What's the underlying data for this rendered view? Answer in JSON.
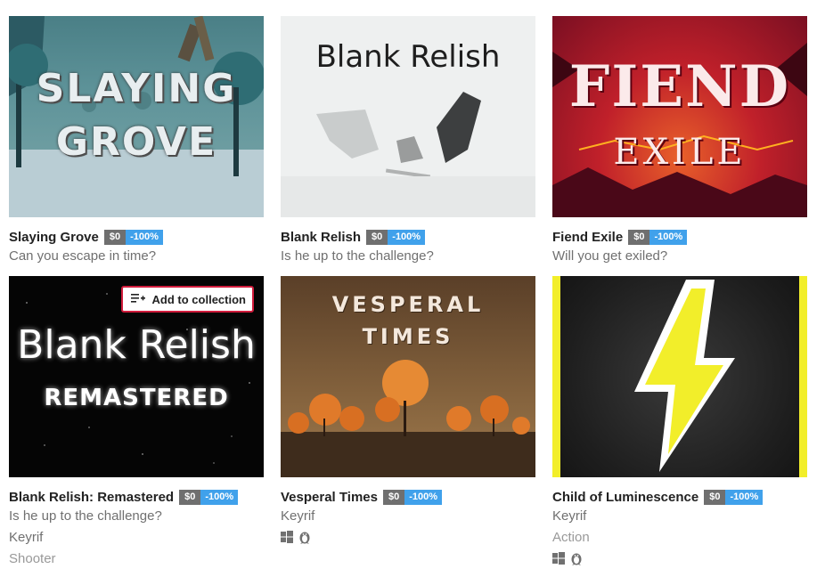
{
  "games": [
    {
      "title": "Slaying Grove",
      "price": "$0",
      "discount": "-100%",
      "description": "Can you escape in time?",
      "cover_text": [
        "SLAYING",
        "GROVE"
      ]
    },
    {
      "title": "Blank Relish",
      "price": "$0",
      "discount": "-100%",
      "description": "Is he up to the challenge?",
      "cover_text": [
        "Blank Relish"
      ]
    },
    {
      "title": "Fiend Exile",
      "price": "$0",
      "discount": "-100%",
      "description": "Will you get exiled?",
      "cover_text": [
        "FIEND",
        "EXILE"
      ]
    },
    {
      "title": "Blank Relish: Remastered",
      "price": "$0",
      "discount": "-100%",
      "description": "Is he up to the challenge?",
      "author": "Keyrif",
      "genre": "Shooter",
      "cover_text": [
        "Blank Relish",
        "REMASTERED"
      ],
      "add_to_collection_label": "Add to collection"
    },
    {
      "title": "Vesperal Times",
      "price": "$0",
      "discount": "-100%",
      "author": "Keyrif",
      "platforms": [
        "windows-icon",
        "linux-icon"
      ],
      "cover_text": [
        "VESPERAL",
        "TIMES"
      ]
    },
    {
      "title": "Child of Luminescence",
      "price": "$0",
      "discount": "-100%",
      "author": "Keyrif",
      "genre": "Action",
      "platforms": [
        "windows-icon",
        "linux-icon"
      ]
    }
  ],
  "colors": {
    "price_bg": "#6f6f6f",
    "sale_bg": "#40a1eb",
    "highlight_border": "#d11c3c"
  }
}
